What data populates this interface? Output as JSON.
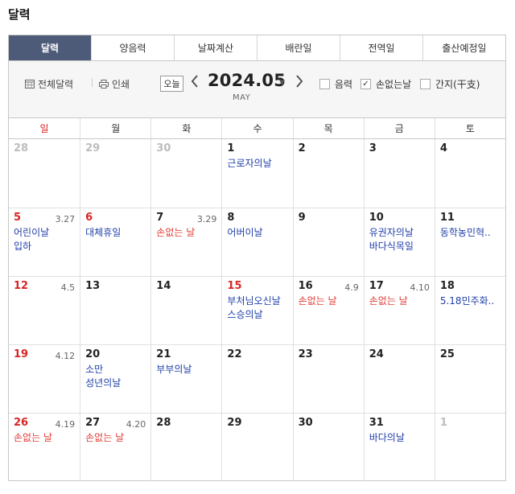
{
  "page": {
    "title": "달력"
  },
  "tabs": [
    {
      "label": "달력",
      "active": true
    },
    {
      "label": "양음력",
      "active": false
    },
    {
      "label": "날짜계산",
      "active": false
    },
    {
      "label": "배란일",
      "active": false
    },
    {
      "label": "전역일",
      "active": false
    },
    {
      "label": "출산예정일",
      "active": false
    }
  ],
  "toolbar": {
    "full_calendar": "전체달력",
    "print": "인쇄",
    "today": "오늘",
    "month": "2024.05",
    "month_en": "MAY",
    "prev_icon": "chevron-left-icon",
    "next_icon": "chevron-right-icon",
    "options": [
      {
        "label": "음력",
        "checked": false
      },
      {
        "label": "손없는날",
        "checked": true
      },
      {
        "label": "간지(干支)",
        "checked": false
      }
    ]
  },
  "colors": {
    "active_tab": "#4d5a78",
    "sunday": "#d92525",
    "holiday_event": "#1f3fa8",
    "son_event": "#e0403a",
    "other_month": "#bdbdbd"
  },
  "weekdays": [
    "일",
    "월",
    "화",
    "수",
    "목",
    "금",
    "토"
  ],
  "weeks": [
    [
      {
        "day": "28",
        "other": true,
        "lunar": "",
        "events": []
      },
      {
        "day": "29",
        "other": true,
        "lunar": "",
        "events": []
      },
      {
        "day": "30",
        "other": true,
        "lunar": "",
        "events": []
      },
      {
        "day": "1",
        "lunar": "",
        "events": [
          {
            "text": "근로자의날"
          }
        ]
      },
      {
        "day": "2",
        "lunar": "",
        "events": []
      },
      {
        "day": "3",
        "lunar": "",
        "events": []
      },
      {
        "day": "4",
        "lunar": "",
        "events": []
      }
    ],
    [
      {
        "day": "5",
        "red": true,
        "lunar": "3.27",
        "events": [
          {
            "text": "어린이날"
          },
          {
            "text": "입하"
          }
        ]
      },
      {
        "day": "6",
        "red": true,
        "lunar": "",
        "events": [
          {
            "text": "대체휴일"
          }
        ]
      },
      {
        "day": "7",
        "lunar": "3.29",
        "events": [
          {
            "text": "손없는 날",
            "red": true
          }
        ]
      },
      {
        "day": "8",
        "lunar": "",
        "events": [
          {
            "text": "어버이날"
          }
        ]
      },
      {
        "day": "9",
        "lunar": "",
        "events": []
      },
      {
        "day": "10",
        "lunar": "",
        "events": [
          {
            "text": "유권자의날"
          },
          {
            "text": "바다식목일"
          }
        ]
      },
      {
        "day": "11",
        "lunar": "",
        "events": [
          {
            "text": "동학농민혁.."
          }
        ]
      }
    ],
    [
      {
        "day": "12",
        "red": true,
        "lunar": "4.5",
        "events": []
      },
      {
        "day": "13",
        "lunar": "",
        "events": []
      },
      {
        "day": "14",
        "lunar": "",
        "events": []
      },
      {
        "day": "15",
        "red": true,
        "lunar": "",
        "events": [
          {
            "text": "부처님오신날"
          },
          {
            "text": "스승의날"
          }
        ]
      },
      {
        "day": "16",
        "lunar": "4.9",
        "events": [
          {
            "text": "손없는 날",
            "red": true
          }
        ]
      },
      {
        "day": "17",
        "lunar": "4.10",
        "events": [
          {
            "text": "손없는 날",
            "red": true
          }
        ]
      },
      {
        "day": "18",
        "lunar": "",
        "events": [
          {
            "text": "5.18민주화.."
          }
        ]
      }
    ],
    [
      {
        "day": "19",
        "red": true,
        "lunar": "4.12",
        "events": []
      },
      {
        "day": "20",
        "lunar": "",
        "events": [
          {
            "text": "소만"
          },
          {
            "text": "성년의날"
          }
        ]
      },
      {
        "day": "21",
        "lunar": "",
        "events": [
          {
            "text": "부부의날"
          }
        ]
      },
      {
        "day": "22",
        "lunar": "",
        "events": []
      },
      {
        "day": "23",
        "lunar": "",
        "events": []
      },
      {
        "day": "24",
        "lunar": "",
        "events": []
      },
      {
        "day": "25",
        "lunar": "",
        "events": []
      }
    ],
    [
      {
        "day": "26",
        "red": true,
        "lunar": "4.19",
        "events": [
          {
            "text": "손없는 날",
            "red": true
          }
        ]
      },
      {
        "day": "27",
        "lunar": "4.20",
        "events": [
          {
            "text": "손없는 날",
            "red": true
          }
        ]
      },
      {
        "day": "28",
        "lunar": "",
        "events": []
      },
      {
        "day": "29",
        "lunar": "",
        "events": []
      },
      {
        "day": "30",
        "lunar": "",
        "events": []
      },
      {
        "day": "31",
        "lunar": "",
        "events": [
          {
            "text": "바다의날"
          }
        ]
      },
      {
        "day": "1",
        "other": true,
        "lunar": "",
        "events": []
      }
    ]
  ]
}
